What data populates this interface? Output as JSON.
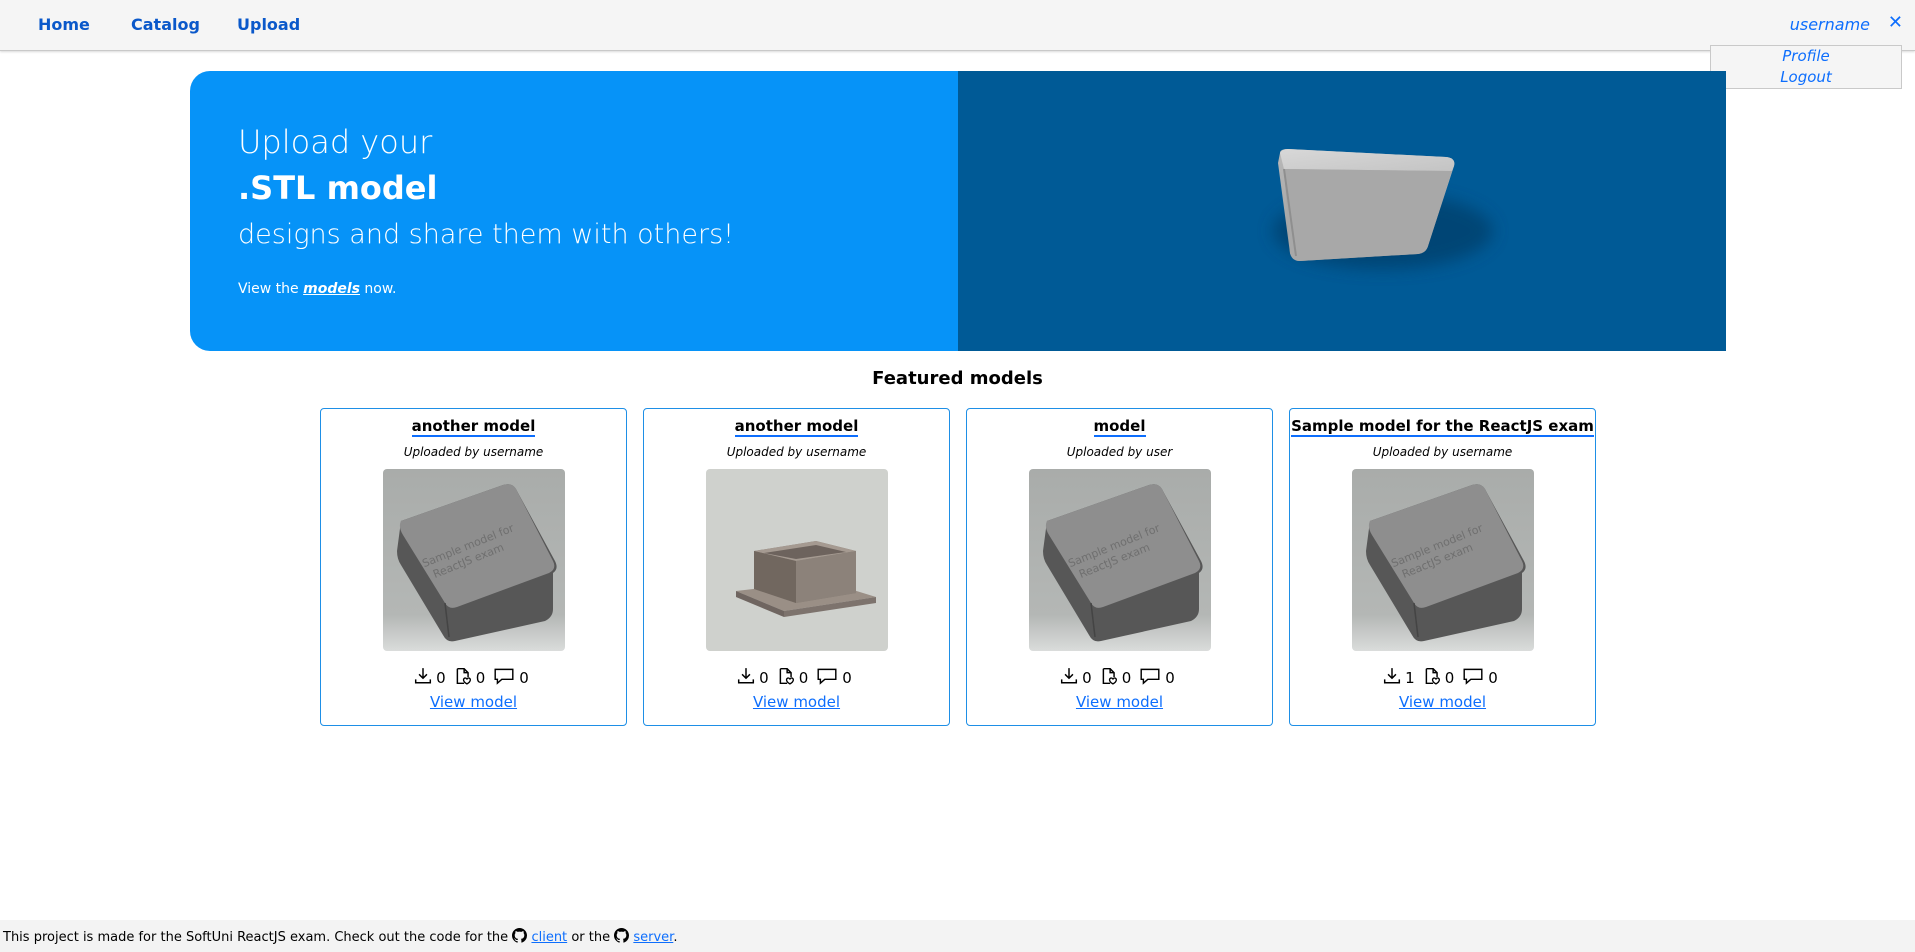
{
  "nav": {
    "home": "Home",
    "catalog": "Catalog",
    "upload": "Upload",
    "username": "username",
    "close_glyph": "✕",
    "menu": {
      "profile": "Profile",
      "logout": "Logout"
    }
  },
  "hero": {
    "line1": "Upload your",
    "line2": ".STL model",
    "line3": "designs and share them with others!",
    "cta_prefix": "View the",
    "cta_link": "models",
    "cta_suffix": "now."
  },
  "featured": {
    "title": "Featured models",
    "view_label": "View model",
    "cards": [
      {
        "title": "another model",
        "by": "Uploaded by username",
        "downloads": "0",
        "likes": "0",
        "comments": "0",
        "thumb": "box-lid"
      },
      {
        "title": "another model",
        "by": "Uploaded by username",
        "downloads": "0",
        "likes": "0",
        "comments": "0",
        "thumb": "box-open"
      },
      {
        "title": "model",
        "by": "Uploaded by user",
        "downloads": "0",
        "likes": "0",
        "comments": "0",
        "thumb": "box-lid"
      },
      {
        "title": "Sample model for the ReactJS exam",
        "by": "Uploaded by username",
        "downloads": "1",
        "likes": "0",
        "comments": "0",
        "thumb": "box-lid"
      }
    ],
    "thumb_text": [
      "Sample model for",
      "ReactJS exam"
    ]
  },
  "footer": {
    "text": "This project is made for the SoftUni ReactJS exam. Check out the code for the",
    "client": "client",
    "or": "or the",
    "server": "server",
    "end": "."
  },
  "colors": {
    "hero_left": "#0693f8",
    "hero_right": "#005a96",
    "link": "#0d6efd",
    "card_border": "#1e8fe6"
  }
}
